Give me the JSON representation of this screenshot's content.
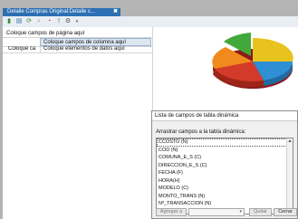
{
  "tab": {
    "title": "Detalle Compras Original:Detalle c...",
    "close": "✖"
  },
  "toolbar": {
    "icons": [
      "new-icon",
      "open-icon",
      "refresh-icon",
      "wizard-icon",
      "chart-icon",
      "export-icon",
      "dropdown-icon"
    ]
  },
  "pivot": {
    "page_fields_label": "Coloque campos de página aquí",
    "column_fields_label": "Coloque campos de columna aquí",
    "row_fields_label": "Coloque ca",
    "data_fields_label": "Coloque elementos de datos aquí"
  },
  "field_panel": {
    "title": "Lista de campos de tabla dinámica",
    "instruction": "Arrastrar campos a la tabla dinámica:",
    "fields": [
      "CCOSTO (N)",
      "COD (N)",
      "COMUNA_E_S (C)",
      "DIRECCION_E_S (C)",
      "FECHA (F)",
      "HORA(H)",
      "MODELO (C)",
      "MONTO_TRANS (N)",
      "Nº_TRANSACCION (N)"
    ],
    "buttons": {
      "add": "Agregar a",
      "remove": "Quitar",
      "close": "Cerrar"
    }
  },
  "colors": {
    "tab": "#2d6fb3",
    "column_zone": "#dce6f1"
  }
}
